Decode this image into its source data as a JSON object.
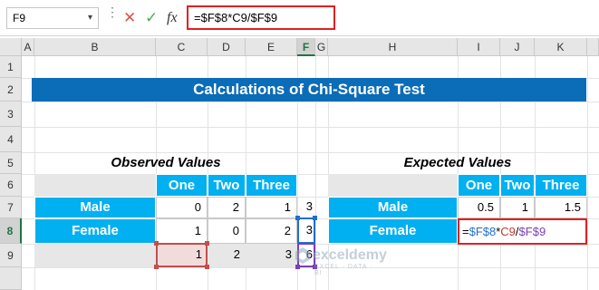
{
  "formula_bar": {
    "name_box": "F9",
    "cancel_icon": "✕",
    "enter_icon": "✓",
    "fx_icon": "fx",
    "formula": "=$F$8*C9/$F$9"
  },
  "columns": [
    "A",
    "B",
    "C",
    "D",
    "E",
    "F",
    "G",
    "H",
    "I",
    "J",
    "K"
  ],
  "rows": [
    "1",
    "2",
    "3",
    "4",
    "5",
    "6",
    "7",
    "8",
    "9"
  ],
  "title": "Calculations of Chi-Square Test",
  "observed": {
    "heading": "Observed Values",
    "headers": [
      "One",
      "Two",
      "Three"
    ],
    "rows": [
      {
        "label": "Male",
        "values": [
          "0",
          "2",
          "1"
        ],
        "total": "3"
      },
      {
        "label": "Female",
        "values": [
          "1",
          "0",
          "2"
        ],
        "total": "3"
      }
    ],
    "col_totals": [
      "1",
      "2",
      "3"
    ],
    "grand_total": "6"
  },
  "expected": {
    "heading": "Expected Values",
    "headers": [
      "One",
      "Two",
      "Three"
    ],
    "male_label": "Male",
    "male_values": [
      "0.5",
      "1",
      "1.5"
    ],
    "female_label": "Female",
    "formula_parts": [
      "=",
      "$F$8",
      "*",
      "C9",
      "/",
      "$F$9"
    ]
  },
  "watermark": {
    "name": "exceldemy",
    "tagline": "EXCEL · DATA · BI"
  },
  "colors": {
    "banner": "#0b6cb7",
    "header_blue": "#00b0f0",
    "error_red": "#e0201f"
  }
}
